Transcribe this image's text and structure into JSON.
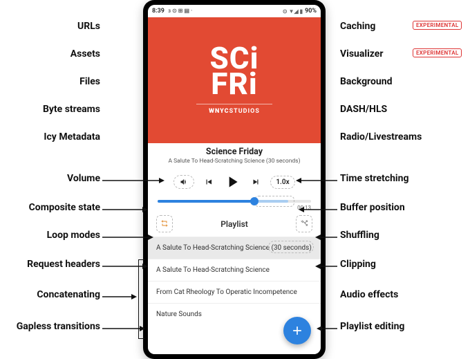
{
  "status": {
    "time": "8:39",
    "left_icons": "ᴈ ⊙ ⊞ ▤ ·",
    "right_icons": "⊙ ▼◢ ▮",
    "battery_pct": "90%"
  },
  "art": {
    "line1": "SCi",
    "line2": "FRi",
    "studio_a": "WNYC",
    "studio_b": "STUDIOS"
  },
  "track": {
    "title": "Science Friday",
    "subtitle": "A Salute To Head-Scratching Science (30 seconds)"
  },
  "controls": {
    "speed": "1.0x"
  },
  "progress": {
    "time": "00:13"
  },
  "playlist": {
    "title": "Playlist",
    "items": [
      "A Salute To Head-Scratching Science (30 seconds)",
      "A Salute To Head-Scratching Science",
      "From Cat Rheology To Operatic Incompetence",
      "Nature Sounds"
    ]
  },
  "labels": {
    "left": [
      "URLs",
      "Assets",
      "Files",
      "Byte streams",
      "Icy Metadata",
      "Volume",
      "Composite state",
      "Loop modes",
      "Request headers",
      "Concatenating",
      "Gapless transitions"
    ],
    "right": [
      "Caching",
      "Visualizer",
      "Background",
      "DASH/HLS",
      "Radio/Livestreams",
      "Time stretching",
      "Buffer position",
      "Shuffling",
      "Clipping",
      "Audio effects",
      "Playlist editing"
    ]
  },
  "badge": "EXPERIMENTAL"
}
